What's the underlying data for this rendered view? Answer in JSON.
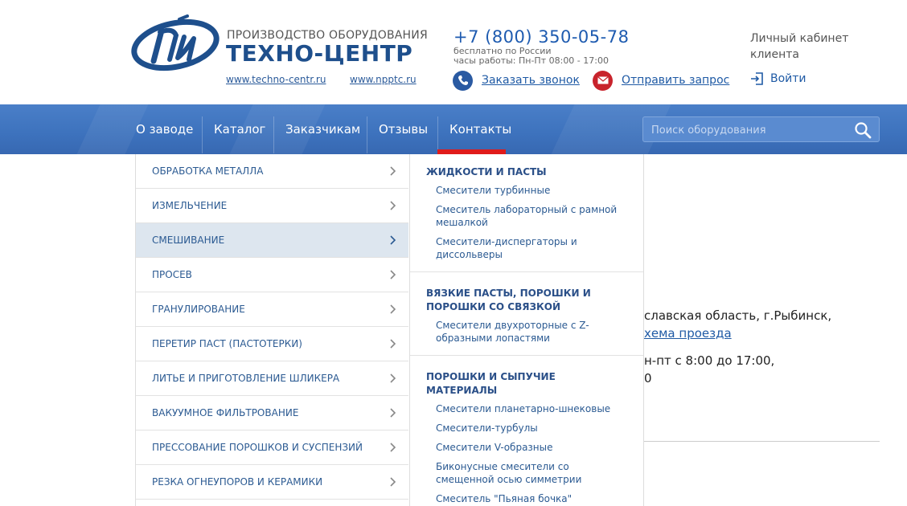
{
  "header": {
    "company_subtitle": "ПРОИЗВОДСТВО ОБОРУДОВАНИЯ",
    "company_name": "ТЕХНО-ЦЕНТР",
    "site_links": [
      "www.techno-centr.ru",
      "www.npptc.ru"
    ],
    "phone": "+7 (800) 350-05-78",
    "phone_note_1": "бесплатно по России",
    "phone_note_2": "часы работы: Пн-Пт 08:00 - 17:00",
    "call_label": "Заказать звонок",
    "request_label": "Отправить запрос",
    "cabinet_line1": "Личный кабинет",
    "cabinet_line2": "клиента",
    "login_label": "Войти",
    "colors": {
      "brand_blue": "#1e4f8c",
      "call_icon": "#2a5aa2",
      "request_icon": "#c8232c"
    }
  },
  "nav": {
    "items": [
      "О заводе",
      "Каталог",
      "Заказчикам",
      "Отзывы",
      "Контакты"
    ],
    "active": "Контакты",
    "search_placeholder": "Поиск оборудования",
    "colors": {
      "bar": "#3d72bd",
      "active_marker": "#e01b1b"
    }
  },
  "background_content": {
    "line1": "славская область, г.Рыбинск,",
    "line2_link": "хема проезда",
    "line3": "н-пт с 8:00 до 17:00,",
    "line4": "0"
  },
  "catalog": {
    "items": [
      "ОБРАБОТКА МЕТАЛЛА",
      "ИЗМЕЛЬЧЕНИЕ",
      "СМЕШИВАНИЕ",
      "ПРОСЕВ",
      "ГРАНУЛИРОВАНИЕ",
      "ПЕРЕТИР ПАСТ (ПАСТОТЕРКИ)",
      "ЛИТЬЕ И ПРИГОТОВЛЕНИЕ ШЛИКЕРА",
      "ВАКУУМНОЕ ФИЛЬТРОВАНИЕ",
      "ПРЕССОВАНИЕ ПОРОШКОВ И СУСПЕНЗИЙ",
      "РЕЗКА ОГНЕУПОРОВ И КЕРАМИКИ"
    ],
    "active": "СМЕШИВАНИЕ",
    "active_color": "#dde6ef"
  },
  "submenu": {
    "groups": [
      {
        "title": "ЖИДКОСТИ И ПАСТЫ",
        "links": [
          "Смесители турбинные",
          "Смеситель лабораторный с рамной мешалкой",
          "Смесители-диспергаторы и диссольверы"
        ]
      },
      {
        "title": "ВЯЗКИЕ ПАСТЫ, ПОРОШКИ И ПОРОШКИ СО СВЯЗКОЙ",
        "links": [
          "Смесители двухроторные с Z-образными лопастями"
        ]
      },
      {
        "title": "ПОРОШКИ И СЫПУЧИЕ МАТЕРИАЛЫ",
        "links": [
          "Смесители планетарно-шнековые",
          "Смесители-турбулы",
          "Смесители V-образные",
          "Биконусные смесители со смещенной осью симметрии",
          "Смеситель \"Пьяная бочка\""
        ]
      }
    ]
  }
}
